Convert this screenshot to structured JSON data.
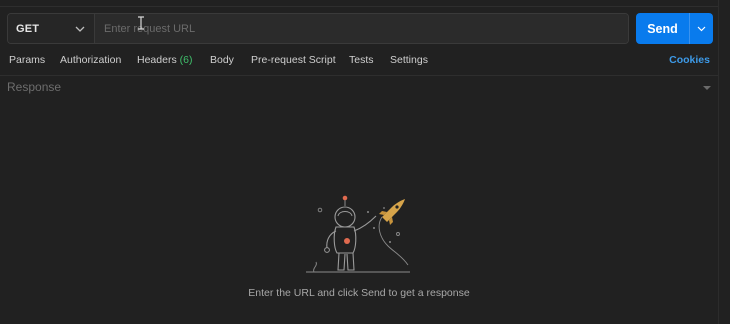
{
  "request": {
    "method": "GET",
    "url_placeholder": "Enter request URL",
    "url_value": ""
  },
  "send": {
    "label": "Send"
  },
  "tabs": {
    "params": "Params",
    "authorization": "Authorization",
    "headers": "Headers",
    "headers_count": "(6)",
    "body": "Body",
    "prerequest": "Pre-request Script",
    "tests": "Tests",
    "settings": "Settings"
  },
  "cookies_label": "Cookies",
  "response": {
    "title": "Response",
    "empty_message": "Enter the URL and click Send to get a response"
  },
  "colors": {
    "send_button": "#097bed",
    "cookies_link": "#3d9ae8",
    "headers_count": "#3fbf6b"
  },
  "icons": {
    "method_dropdown": "chevron-down-icon",
    "send_dropdown": "chevron-down-icon",
    "response_toggle": "caret-down-icon",
    "illustration": "astronaut-rocket-illustration",
    "cursor": "text-cursor-icon"
  }
}
